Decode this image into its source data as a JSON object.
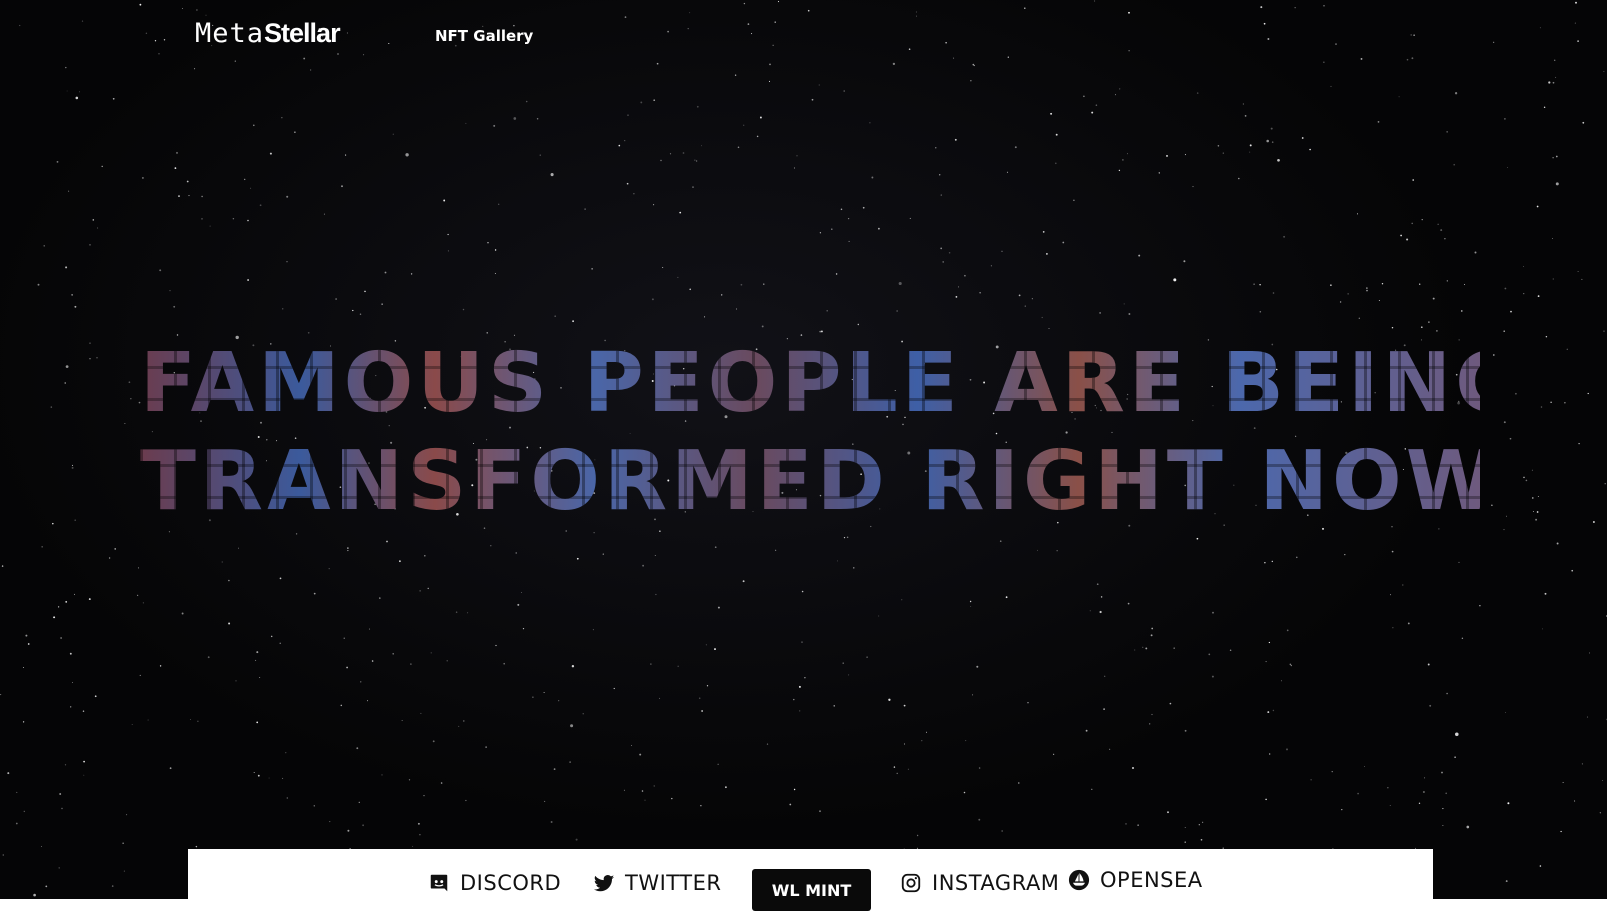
{
  "header": {
    "logo_part1": "Meta",
    "logo_part2": "Stellar",
    "nav_gallery": "NFT Gallery"
  },
  "hero": {
    "line1": "FAMOUS PEOPLE ARE BEING",
    "line2": "TRANSFORMED RIGHT NOW"
  },
  "footer": {
    "discord": "DISCORD",
    "twitter": "TWITTER",
    "mint": "WL MINT",
    "instagram": "INSTAGRAM",
    "opensea": "OPENSEA"
  },
  "icons": {
    "discord": "discord-icon",
    "twitter": "twitter-icon",
    "instagram": "instagram-icon",
    "opensea": "opensea-icon"
  },
  "colors": {
    "background": "#050506",
    "text": "#ffffff",
    "bar": "#ffffff",
    "button": "#0a0a0a"
  }
}
